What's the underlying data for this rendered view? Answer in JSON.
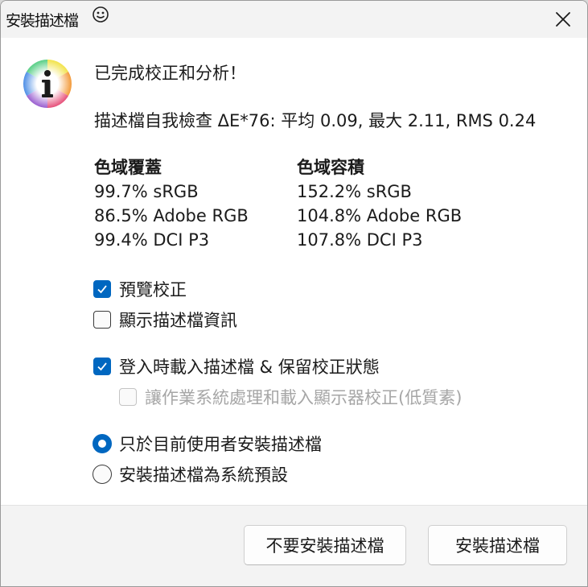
{
  "window": {
    "title": "安裝描述檔"
  },
  "message": {
    "headline": "已完成校正和分析！",
    "summary": "描述檔自我檢查 ΔE*76: 平均 0.09, 最大 2.11, RMS 0.24"
  },
  "gamut_coverage": {
    "heading": "色域覆蓋",
    "rows": [
      "99.7% sRGB",
      "86.5% Adobe RGB",
      "99.4% DCI P3"
    ]
  },
  "gamut_volume": {
    "heading": "色域容積",
    "rows": [
      "152.2% sRGB",
      "104.8% Adobe RGB",
      "107.8% DCI P3"
    ]
  },
  "options": {
    "preview_calibration": {
      "label": "預覽校正",
      "checked": true
    },
    "show_profile_info": {
      "label": "顯示描述檔資訊",
      "checked": false
    },
    "load_on_login": {
      "label": "登入時載入描述檔 & 保留校正狀態",
      "checked": true
    },
    "os_handles_loading": {
      "label": "讓作業系統處理和載入顯示器校正(低質素)",
      "checked": false,
      "enabled": false
    }
  },
  "install_scope": {
    "current_user": {
      "label": "只於目前使用者安裝描述檔",
      "selected": true
    },
    "system_default": {
      "label": "安裝描述檔為系統預設",
      "selected": false
    }
  },
  "buttons": {
    "dont_install": "不要安裝描述檔",
    "install": "安裝描述檔"
  },
  "colors": {
    "accent": "#0067c0",
    "dialog_bg": "#ffffff",
    "footer_bg": "#f3f3f3"
  }
}
